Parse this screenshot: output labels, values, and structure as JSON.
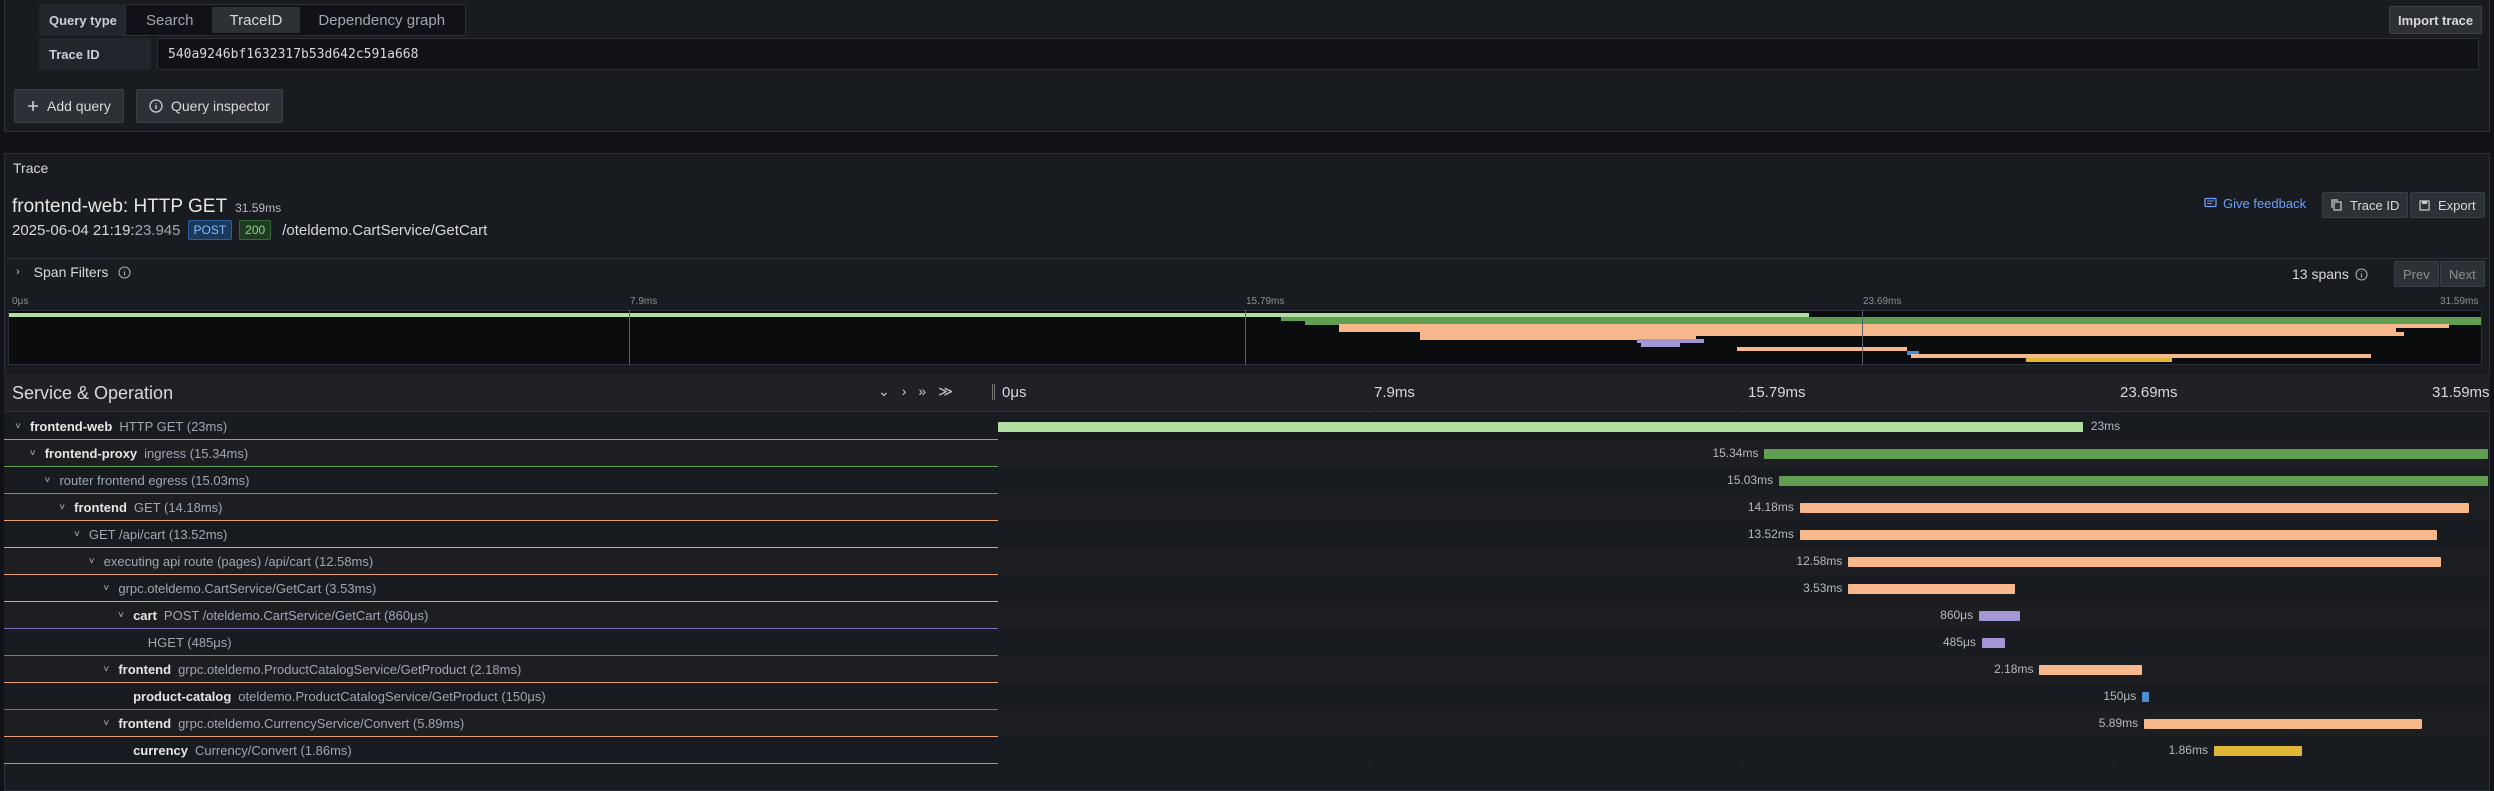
{
  "query": {
    "type_label": "Query type",
    "types": [
      "Search",
      "TraceID",
      "Dependency graph"
    ],
    "active_type": "TraceID",
    "trace_id_label": "Trace ID",
    "trace_id_value": "540a9246bf1632317b53d642c591a668",
    "import_label": "Import trace",
    "add_query_label": "Add query",
    "inspector_label": "Query inspector"
  },
  "trace": {
    "panel_title": "Trace",
    "title": "frontend-web: HTTP GET",
    "duration": "31.59ms",
    "date": "2025-06-04 21:19:",
    "time_ms": "23.945",
    "method": "POST",
    "status": "200",
    "url": "/oteldemo.CartService/GetCart",
    "feedback_label": "Give feedback",
    "traceid_btn": "Trace ID",
    "export_btn": "Export",
    "span_filters_label": "Span Filters",
    "spans_count": "13 spans",
    "prev": "Prev",
    "next": "Next"
  },
  "timeline": {
    "ticks": [
      "0μs",
      "7.9ms",
      "15.79ms",
      "23.69ms",
      "31.59ms"
    ],
    "header": "Service & Operation"
  },
  "spans": [
    {
      "depth": 0,
      "svc": "frontend-web",
      "op": "HTTP GET (23ms)",
      "start": 0,
      "end": 23,
      "dur": "23ms",
      "label_side": "right",
      "color": "#b1dfa1",
      "line": "#7eb26d"
    },
    {
      "depth": 1,
      "svc": "frontend-proxy",
      "op": "ingress (15.34ms)",
      "start": 16.25,
      "end": 31.59,
      "dur": "15.34ms",
      "label_side": "left",
      "color": "#629e51",
      "line": "#629e51"
    },
    {
      "depth": 2,
      "svc": "",
      "op": "router frontend egress (15.03ms)",
      "start": 16.56,
      "end": 31.59,
      "dur": "15.03ms",
      "label_side": "left",
      "color": "#629e51",
      "line": "#629e51"
    },
    {
      "depth": 3,
      "svc": "frontend",
      "op": "GET (14.18ms)",
      "start": 17.0,
      "end": 31.18,
      "dur": "14.18ms",
      "label_side": "left",
      "color": "#f7b98b",
      "line": "#e89d70"
    },
    {
      "depth": 4,
      "svc": "",
      "op": "GET /api/cart (13.52ms)",
      "start": 17.0,
      "end": 30.5,
      "dur": "13.52ms",
      "label_side": "left",
      "color": "#f7b98b",
      "line": "#e89d70"
    },
    {
      "depth": 5,
      "svc": "",
      "op": "executing api route (pages) /api/cart (12.58ms)",
      "start": 18.03,
      "end": 30.6,
      "dur": "12.58ms",
      "label_side": "left",
      "color": "#f7b98b",
      "line": "#e89d70"
    },
    {
      "depth": 6,
      "svc": "",
      "op": "grpc.oteldemo.CartService/GetCart (3.53ms)",
      "start": 18.03,
      "end": 21.56,
      "dur": "3.53ms",
      "label_side": "left",
      "color": "#f7b98b",
      "line": "#e89d70"
    },
    {
      "depth": 7,
      "svc": "cart",
      "op": "POST /oteldemo.CartService/GetCart (860μs)",
      "start": 20.8,
      "end": 21.66,
      "dur": "860μs",
      "label_side": "left",
      "color": "#a395d6",
      "line": "#806eb7"
    },
    {
      "depth": 8,
      "svc": "",
      "op": "HGET (485μs)",
      "start": 20.86,
      "end": 21.35,
      "dur": "485μs",
      "label_side": "left",
      "color": "#a395d6",
      "line": "#806eb7"
    },
    {
      "depth": 6,
      "svc": "frontend",
      "op": "grpc.oteldemo.ProductCatalogService/GetProduct (2.18ms)",
      "start": 22.08,
      "end": 24.26,
      "dur": "2.18ms",
      "label_side": "left",
      "color": "#f7b98b",
      "line": "#e89d70"
    },
    {
      "depth": 7,
      "svc": "product-catalog",
      "op": "oteldemo.ProductCatalogService/GetProduct (150μs)",
      "start": 24.26,
      "end": 24.41,
      "dur": "150μs",
      "label_side": "left",
      "color": "#4c8ed4",
      "line": "#447ebc"
    },
    {
      "depth": 6,
      "svc": "frontend",
      "op": "grpc.oteldemo.CurrencyService/Convert (5.89ms)",
      "start": 24.3,
      "end": 30.19,
      "dur": "5.89ms",
      "label_side": "left",
      "color": "#f7b98b",
      "line": "#e89d70"
    },
    {
      "depth": 7,
      "svc": "currency",
      "op": "Currency/Convert (1.86ms)",
      "start": 25.78,
      "end": 27.64,
      "dur": "1.86ms",
      "label_side": "left",
      "color": "#e0b635",
      "line": "#cca300"
    }
  ],
  "colors": {
    "accent": "#6e9fff",
    "method_bg": "#1a3a5c",
    "status_bg": "#1f3b22"
  }
}
